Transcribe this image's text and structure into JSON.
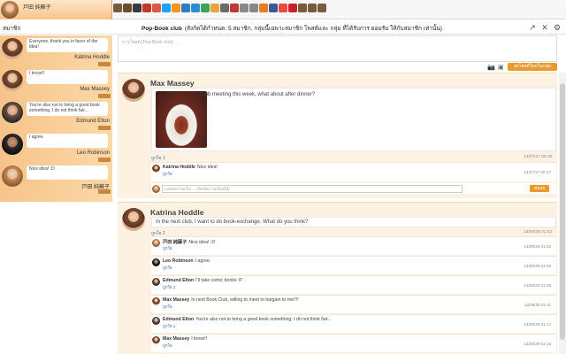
{
  "topbar": {
    "user_name": "戸田 純蘇子"
  },
  "icons": [
    "home-icon",
    "book-icon",
    "cat-icon",
    "apple-icon",
    "bookmark-icon",
    "twitter-icon",
    "rss-icon",
    "window-icon",
    "app-icon",
    "app-icon",
    "app-icon",
    "home2-icon",
    "warning-icon",
    "info-icon",
    "info2-icon",
    "star-icon",
    "facebook-icon",
    "star2-icon",
    "pinterest-icon",
    "dots-icon",
    "dots2-icon",
    "dots3-icon"
  ],
  "colors": {
    "accent": "#e89a2d",
    "sidebar": "#f6c48a",
    "link": "#3b6db3"
  },
  "secbar": {
    "label": "สมาชิก",
    "title": "Pop-Book club",
    "subtitle": "(สังกัดได้กําหนด: 5 สมาชิก, กลุ่มนี้เฉพาะสมาชิก โพสต์และ กลุ่ม ที่ได้รับการ ยอมรับ ให้กับสมาชิก เท่านั้น)"
  },
  "sidebar": [
    {
      "text": "Everyone, thank you in favor of the idea!",
      "name": "Katrina Hoddle",
      "av": "f"
    },
    {
      "text": "I know!!",
      "name": "Max Massey",
      "av": "f"
    },
    {
      "text": "You're also not to bring a good book something, I do not think fair...",
      "name": "Edmund Elton",
      "av": "m1"
    },
    {
      "text": "I agree.",
      "name": "Leo Robinson",
      "av": "m2"
    },
    {
      "text": "Nice idea! :D",
      "name": "戸田 純蘇子",
      "av": "a"
    }
  ],
  "composer": {
    "placeholder": "การโพสต์ [Pop-Book club] . . .",
    "post_button": "ส่งโพสต์ใหม่ในกลุ่ม"
  },
  "posts": [
    {
      "name": "Max Massey",
      "text": "Club meeting this week, what about after dinner?",
      "meta": "ถูกใจ 1",
      "date": "14/07/27 00:15",
      "comments": [
        {
          "name": "Katrina Hoddle",
          "text": "Nice idea!",
          "meta": "ถูกใจ",
          "date": "14/07/27 00:17"
        }
      ],
      "input": "แสดงความเห็น ... (พิมพ์ความเห็นที่นี่)",
      "send": "ส่งเลย"
    },
    {
      "name": "Katrina Hoddle",
      "text": "In the next club, I want to do book-exchange. What do you think?",
      "meta": "ถูกใจ 2",
      "date": "13/08/29 01:02",
      "comments": [
        {
          "name": "戸田 純蘇子",
          "text": "Nice idea! :D",
          "meta": "ถูกใจ",
          "date": "13/08/29 01:03"
        },
        {
          "name": "Leo Robinson",
          "text": "I agree.",
          "meta": "ถูกใจ",
          "date": "13/08/29 01:05"
        },
        {
          "name": "Edmund Elton",
          "text": "I'll take comic books :P",
          "meta": "ถูกใจ 1",
          "date": "13/08/29 01:08"
        },
        {
          "name": "Max Massey",
          "text": "In next Book Club, willing to meet to bargain to me!!!!",
          "meta": "ถูกใจ",
          "date": "13/08/29 01:11"
        },
        {
          "name": "Edmund Elton",
          "text": "You're also not to bring a good book something, I do not think fair...",
          "meta": "ถูกใจ 1",
          "date": "13/08/29 01:14"
        },
        {
          "name": "Max Massey",
          "text": "I know!!",
          "meta": "ถูกใจ",
          "date": "13/08/29 01:15"
        }
      ]
    }
  ]
}
